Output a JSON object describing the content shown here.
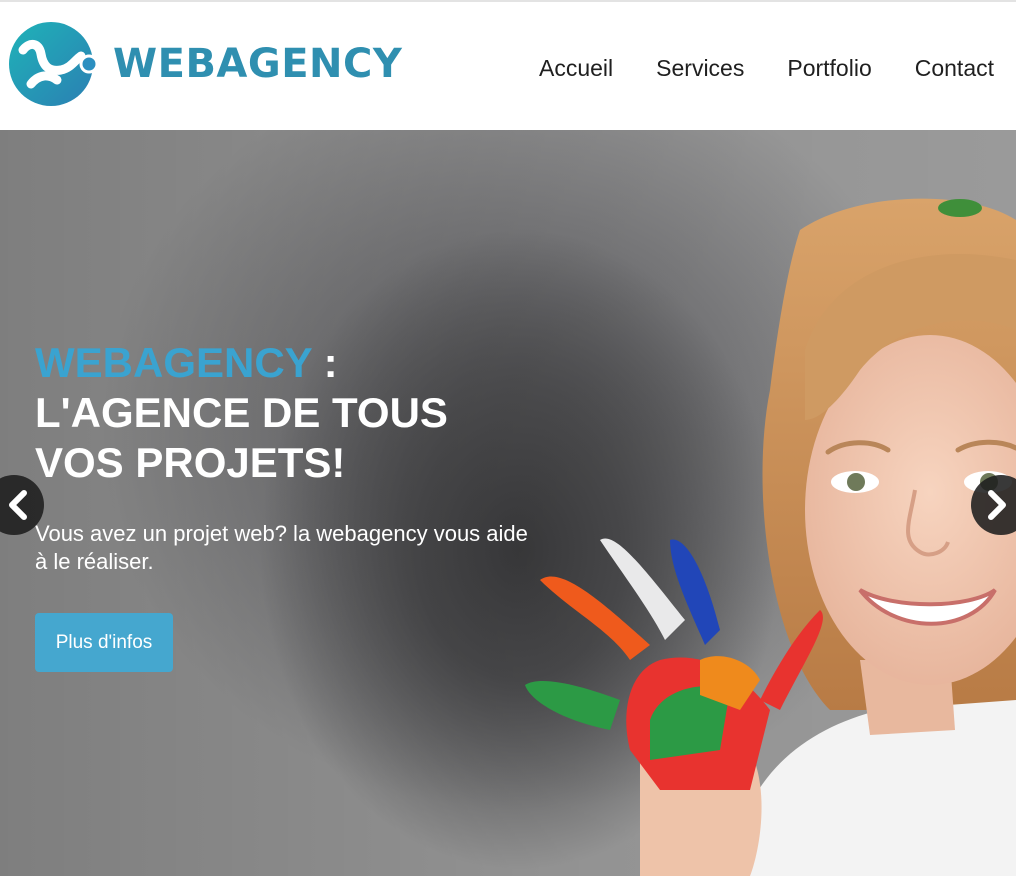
{
  "header": {
    "logo_text": "WEBAGENCY",
    "nav": [
      "Accueil",
      "Services",
      "Portfolio",
      "Contact"
    ]
  },
  "hero": {
    "title_accent": "WEBAGENCY",
    "title_colon": " :",
    "title_line2": "L'AGENCE DE TOUS",
    "title_line3": "VOS PROJETS!",
    "subtitle": "Vous avez un projet web? la webagency vous aide à le réaliser.",
    "cta_label": "Plus d'infos"
  },
  "carousel": {
    "prev_icon": "chevron-left-icon",
    "next_icon": "chevron-right-icon"
  },
  "colors": {
    "brand": "#2f8fb0",
    "accent": "#3aa3d0",
    "button": "#45a7cf",
    "nav_text": "#1f1f1f"
  }
}
